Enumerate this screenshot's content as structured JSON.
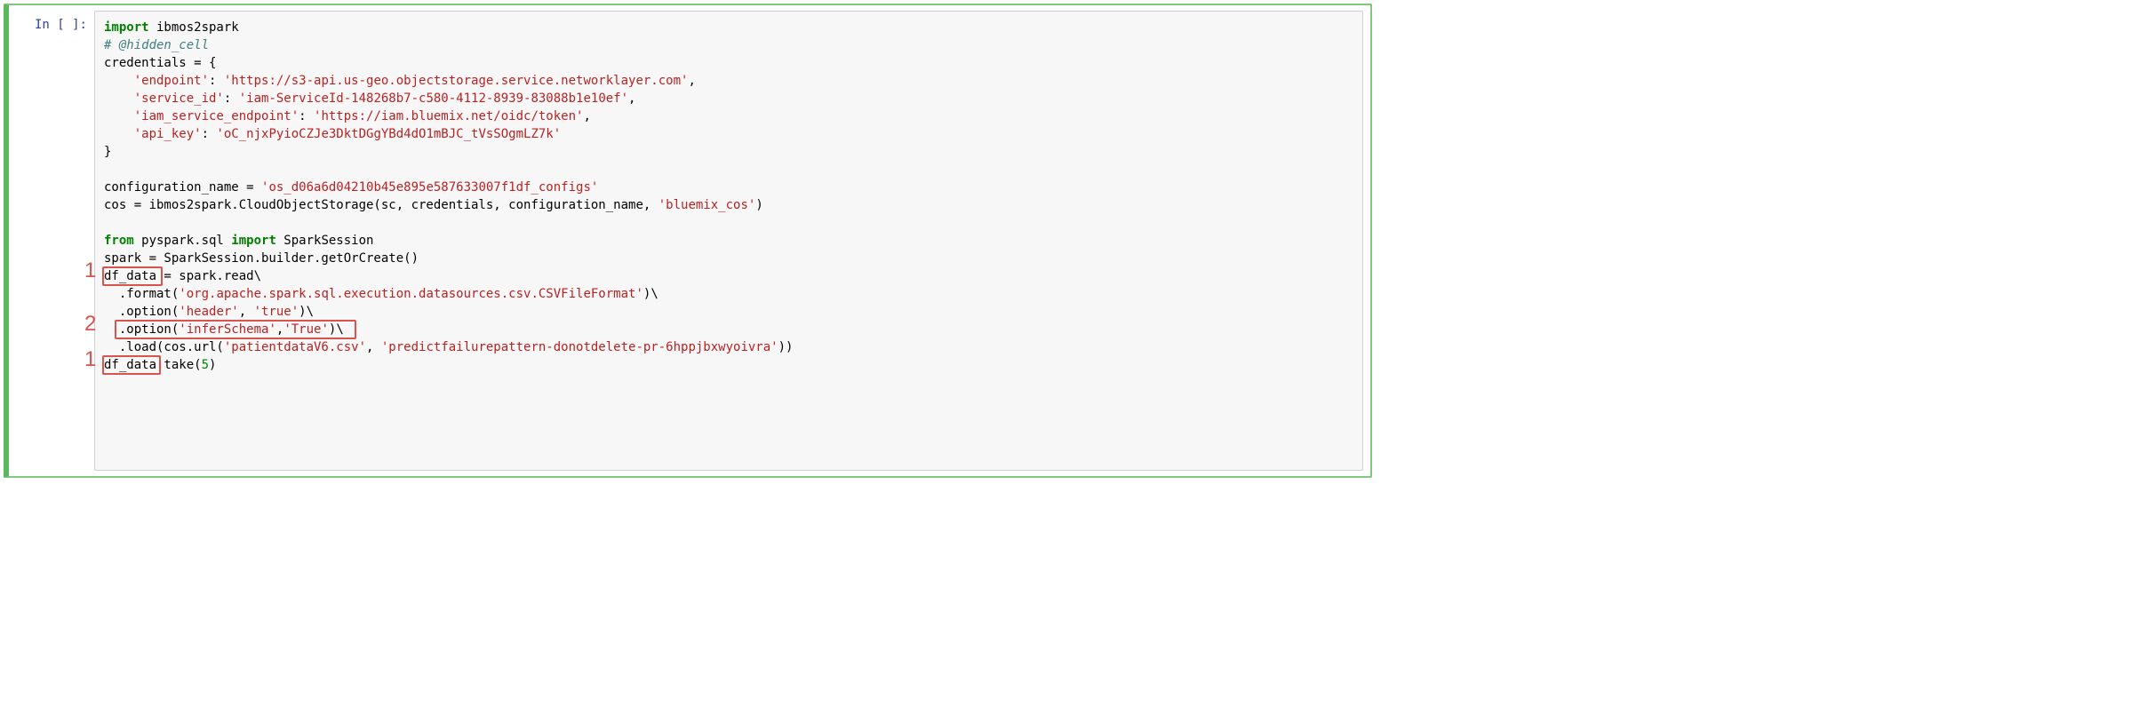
{
  "prompt": "In [ ]:",
  "code": {
    "l1_kw1": "import",
    "l1_mod": " ibmos2spark",
    "l2_comment": "# @hidden_cell",
    "l3": "credentials = {",
    "l4a": "    ",
    "l4s1": "'endpoint'",
    "l4b": ": ",
    "l4s2": "'https://s3-api.us-geo.objectstorage.service.networklayer.com'",
    "l4c": ",",
    "l5a": "    ",
    "l5s1": "'service_id'",
    "l5b": ": ",
    "l5s2": "'iam-ServiceId-148268b7-c580-4112-8939-83088b1e10ef'",
    "l5c": ",",
    "l6a": "    ",
    "l6s1": "'iam_service_endpoint'",
    "l6b": ": ",
    "l6s2": "'https://iam.bluemix.net/oidc/token'",
    "l6c": ",",
    "l7a": "    ",
    "l7s1": "'api_key'",
    "l7b": ": ",
    "l7s2": "'oC_njxPyioCZJe3DktDGgYBd4dO1mBJC_tVsSOgmLZ7k'",
    "l8": "}",
    "l10a": "configuration_name = ",
    "l10s": "'os_d06a6d04210b45e895e587633007f1df_configs'",
    "l11a": "cos = ibmos2spark.CloudObjectStorage(sc, credentials, configuration_name, ",
    "l11s": "'bluemix_cos'",
    "l11b": ")",
    "l13_kw1": "from",
    "l13a": " pyspark.sql ",
    "l13_kw2": "import",
    "l13b": " SparkSession",
    "l14": "spark = SparkSession.builder.getOrCreate()",
    "l15": "df_data = spark.read\\",
    "l16a": "  .format(",
    "l16s": "'org.apache.spark.sql.execution.datasources.csv.CSVFileFormat'",
    "l16b": ")\\",
    "l17a": "  .option(",
    "l17s1": "'header'",
    "l17b": ", ",
    "l17s2": "'true'",
    "l17c": ")\\",
    "l18a": "  .option(",
    "l18s1": "'inferSchema'",
    "l18b": ",",
    "l18s2": "'True'",
    "l18c": ")\\",
    "l19a": "  .load(cos.url(",
    "l19s1": "'patientdataV6.csv'",
    "l19b": ", ",
    "l19s2": "'predictfailurepattern-donotdelete-pr-6hppjbxwyoivra'",
    "l19c": "))",
    "l20a": "df_data.take(",
    "l20n": "5",
    "l20b": ")"
  },
  "annotations": {
    "a1_first": "1",
    "a2": "2",
    "a1_second": "1"
  }
}
